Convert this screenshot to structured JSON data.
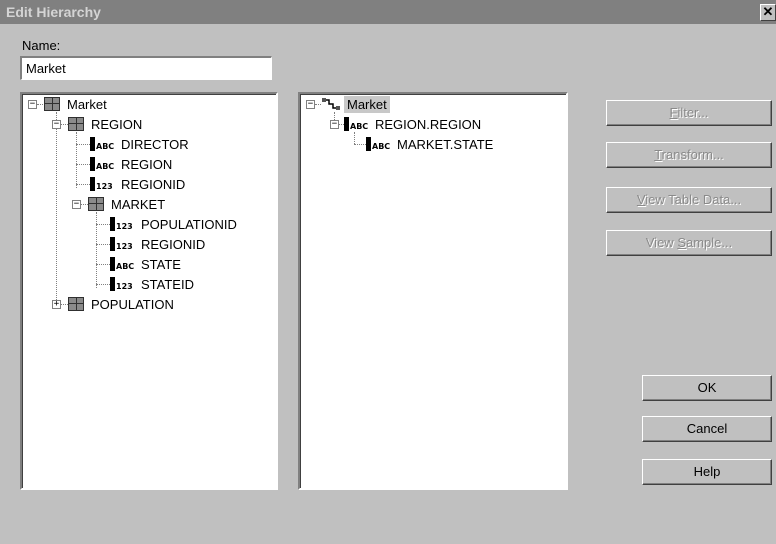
{
  "window": {
    "title": "Edit Hierarchy",
    "close_glyph": "✕"
  },
  "name_field": {
    "label": "Name:",
    "value": "Market"
  },
  "left_tree": [
    {
      "label": "Market",
      "icon": "cube-icon",
      "expander": "minus"
    },
    {
      "label": "REGION",
      "icon": "cube-icon",
      "expander": "minus"
    },
    {
      "label": "DIRECTOR",
      "icon": "abc-field-icon",
      "icon_text": "ABC"
    },
    {
      "label": "REGION",
      "icon": "abc-field-icon",
      "icon_text": "ABC"
    },
    {
      "label": "REGIONID",
      "icon": "number-field-icon",
      "icon_text": "123"
    },
    {
      "label": "MARKET",
      "icon": "cube-icon",
      "expander": "minus"
    },
    {
      "label": "POPULATIONID",
      "icon": "number-field-icon",
      "icon_text": "123"
    },
    {
      "label": "REGIONID",
      "icon": "number-field-icon",
      "icon_text": "123"
    },
    {
      "label": "STATE",
      "icon": "abc-field-icon",
      "icon_text": "ABC"
    },
    {
      "label": "STATEID",
      "icon": "number-field-icon",
      "icon_text": "123"
    },
    {
      "label": "POPULATION",
      "icon": "cube-icon",
      "expander": "plus"
    }
  ],
  "right_tree": [
    {
      "label": "Market",
      "icon": "hierarchy-icon",
      "expander": "minus",
      "selected": true
    },
    {
      "label": "REGION.REGION",
      "icon": "abc-field-icon",
      "icon_text": "ABC",
      "expander": "minus"
    },
    {
      "label": "MARKET.STATE",
      "icon": "abc-field-icon",
      "icon_text": "ABC"
    }
  ],
  "buttons": {
    "filter": {
      "pre": "",
      "key": "F",
      "post": "ilter..."
    },
    "transform": {
      "pre": "",
      "key": "T",
      "post": "ransform..."
    },
    "view_table_data": {
      "pre": "",
      "key": "V",
      "post": "iew Table Data..."
    },
    "view_sample": {
      "pre": "View ",
      "key": "S",
      "post": "ample..."
    },
    "ok": "OK",
    "cancel": "Cancel",
    "help": "Help"
  },
  "colors": {
    "dialog_bg": "#c0c0c0",
    "titlebar_bg": "#808080",
    "disabled_text": "#8a8a8a"
  }
}
